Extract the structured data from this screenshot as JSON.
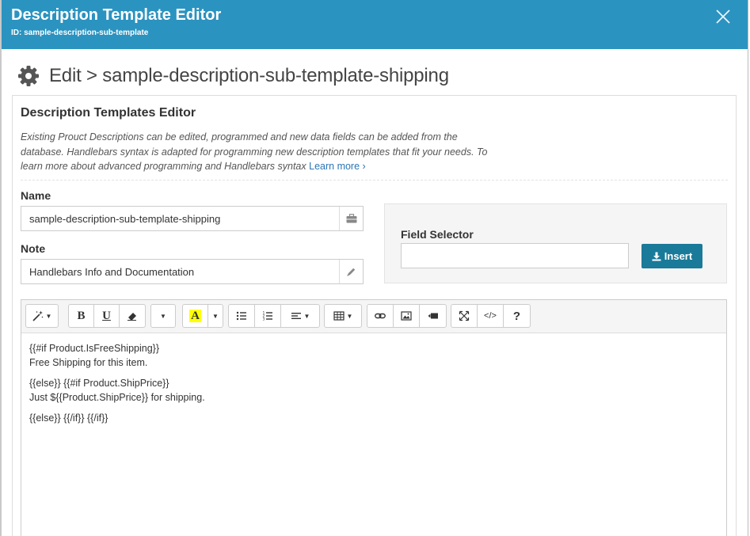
{
  "modal": {
    "title": "Description Template Editor",
    "id_line": "ID: sample-description-sub-template"
  },
  "breadcrumb": {
    "text": "Edit > sample-description-sub-template-shipping"
  },
  "panel": {
    "title": "Description Templates Editor",
    "description": "Existing Prouct Descriptions can be edited, programmed and new data fields can be added from the database. Handlebars syntax is adapted for programming new description templates that fit your needs. To learn more about advanced programming and Handlebars syntax",
    "learn_more": "Learn more ›"
  },
  "form": {
    "name_label": "Name",
    "name_value": "sample-description-sub-template-shipping",
    "note_label": "Note",
    "note_value": "Handlebars Info and Documentation"
  },
  "field_selector": {
    "label": "Field Selector",
    "value": "",
    "insert_label": "Insert"
  },
  "toolbar": {
    "bold": "B",
    "underline": "U",
    "font_color": "A",
    "help": "?",
    "code": "</>"
  },
  "editor": {
    "lines": [
      [
        "{{#if Product.IsFreeShipping}}",
        "Free Shipping for this item."
      ],
      [
        "{{else}} {{#if Product.ShipPrice}}",
        "Just ${{Product.ShipPrice}} for shipping."
      ],
      [
        "{{else}} {{/if}} {{/if}}"
      ]
    ]
  },
  "colors": {
    "header": "#2b93c0",
    "insert_button": "#1a7a99",
    "link": "#2a76b5",
    "highlight": "#ffff00"
  }
}
